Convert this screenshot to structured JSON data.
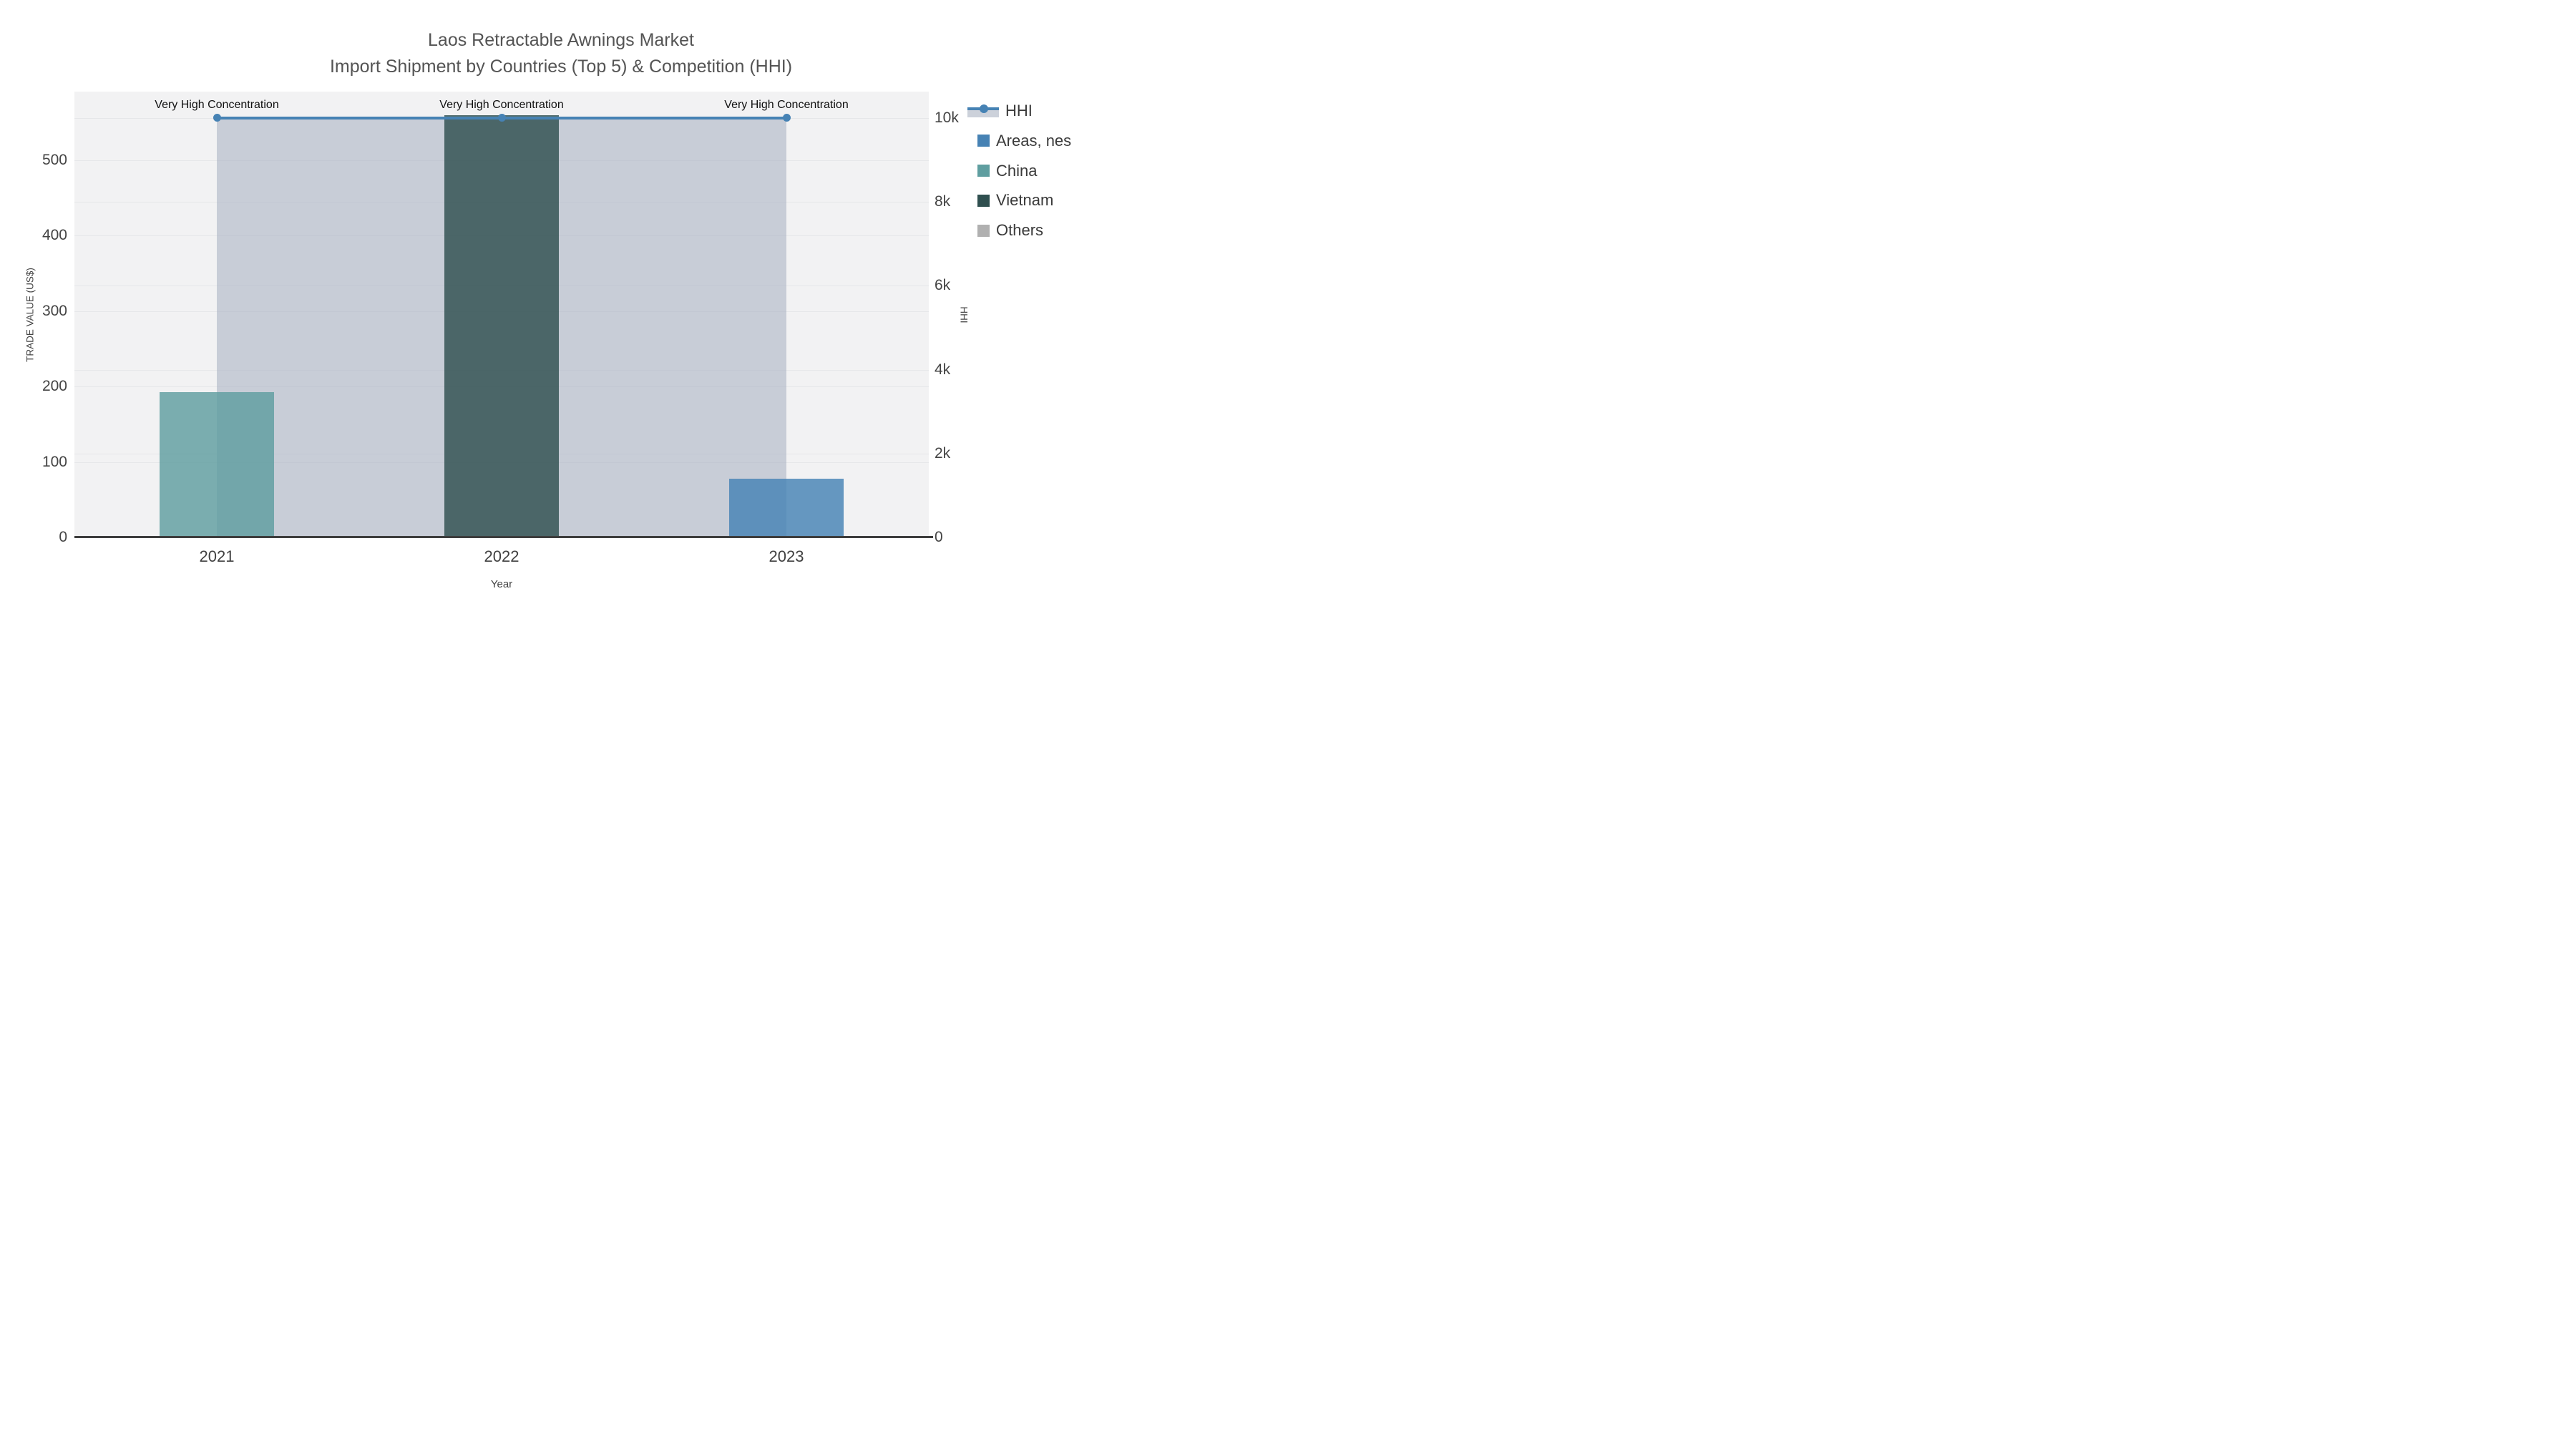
{
  "title": {
    "line1": "Laos Retractable Awnings Market",
    "line2": "Import Shipment by Countries (Top 5) & Competition (HHI)"
  },
  "chart_data": {
    "type": "bar+line dual-axis",
    "categories": [
      "2021",
      "2022",
      "2023"
    ],
    "series": [
      {
        "name": "Areas, nes",
        "color": "#4682B4",
        "values": [
          null,
          null,
          78
        ]
      },
      {
        "name": "China",
        "color": "#5F9EA0",
        "values": [
          193,
          null,
          null
        ]
      },
      {
        "name": "Vietnam",
        "color": "#2F4F4F",
        "values": [
          null,
          560,
          null
        ]
      },
      {
        "name": "Others",
        "color": "#B0B0B0",
        "values": [
          null,
          null,
          null
        ]
      }
    ],
    "hhi_line": {
      "name": "HHI",
      "values": [
        10000,
        10000,
        10000
      ],
      "color": "#4682B4",
      "band_color": "rgba(172,180,196,0.6)"
    },
    "annotations": [
      "Very High Concentration",
      "Very High Concentration",
      "Very High Concentration"
    ],
    "x_axis": {
      "title": "Year"
    },
    "left_axis": {
      "title": "TRADE VALUE (US$)",
      "ticks": [
        "0",
        "100",
        "200",
        "300",
        "400",
        "500"
      ],
      "tick_values": [
        0,
        100,
        200,
        300,
        400,
        500
      ],
      "max": 591
    },
    "right_axis": {
      "title": "HHI",
      "ticks": [
        "0",
        "2k",
        "4k",
        "6k",
        "8k",
        "10k"
      ],
      "tick_values": [
        0,
        2000,
        4000,
        6000,
        8000,
        10000
      ],
      "max": 10630
    },
    "legend_position": "right",
    "grid": true,
    "plot_bg": "#f2f2f3"
  },
  "colors": {
    "grid": "#e6e7e9",
    "axis_line": "#3d3d3d",
    "tick_text": "#444444",
    "title_text": "#545454",
    "annotation_text": "#111111"
  }
}
